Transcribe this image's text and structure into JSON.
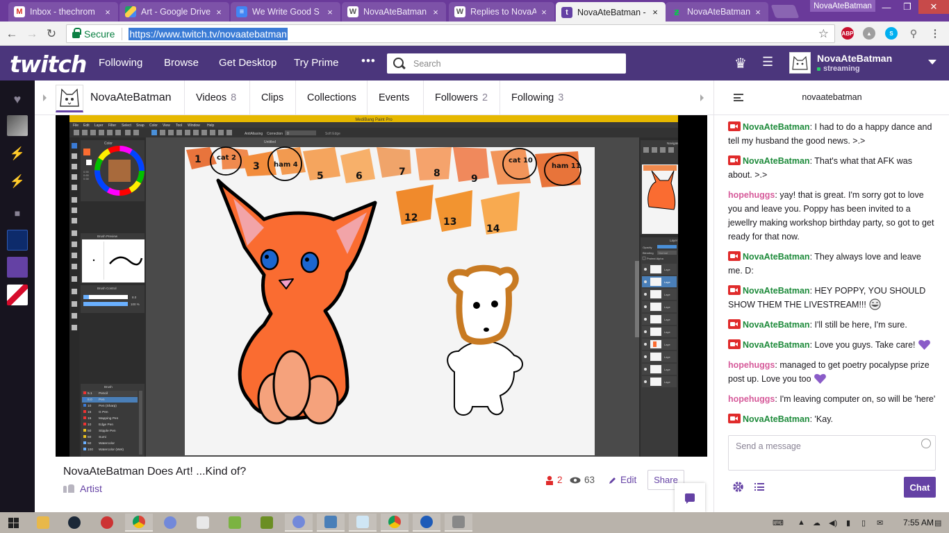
{
  "browser": {
    "tabs": [
      {
        "title": "Inbox - thechrom",
        "favicon": "gmail-icon",
        "color": "#d93025"
      },
      {
        "title": "Art - Google Drive",
        "favicon": "google-drive-icon",
        "color": "#1fa463"
      },
      {
        "title": "We Write Good S",
        "favicon": "google-docs-icon",
        "color": "#4285f4"
      },
      {
        "title": "NovaAteBatman (",
        "favicon": "wordpress-icon",
        "color": "#777"
      },
      {
        "title": "Replies to NovaAt",
        "favicon": "wordpress-icon",
        "color": "#777"
      },
      {
        "title": "NovaAteBatman -",
        "favicon": "twitch-icon",
        "color": "#6441a4",
        "active": true
      },
      {
        "title": "NovaAteBatman (",
        "favicon": "deviantart-icon",
        "color": "#05cc47"
      }
    ],
    "profile_name": "NovaAteBatman",
    "secure_label": "Secure",
    "url": "https://www.twitch.tv/novaatebatman",
    "extensions": [
      "abp-icon",
      "drive-icon",
      "skype-icon",
      "pin-icon"
    ]
  },
  "topnav": {
    "logo": "twitch",
    "links": [
      "Following",
      "Browse",
      "Get Desktop",
      "Try Prime"
    ],
    "more": "•••",
    "search_placeholder": "Search",
    "user": {
      "name": "NovaAteBatman",
      "status": "streaming"
    }
  },
  "channel": {
    "name": "NovaAteBatman",
    "tabs": [
      {
        "label": "Videos",
        "count": "8"
      },
      {
        "label": "Clips",
        "count": ""
      },
      {
        "label": "Collections",
        "count": ""
      },
      {
        "label": "Events",
        "count": ""
      },
      {
        "label": "Followers",
        "count": "2"
      },
      {
        "label": "Following",
        "count": "3"
      }
    ]
  },
  "video": {
    "title": "NovaAteBatman Does Art! ...Kind of?",
    "game": "Artist",
    "viewers": "2",
    "views": "63",
    "edit_label": "Edit",
    "share_label": "Share"
  },
  "stream": {
    "app_title": "MediBang Paint Pro",
    "canvas_title": "Untitled",
    "menu": [
      "File",
      "Edit",
      "Layer",
      "Filter",
      "Select",
      "Snap",
      "Color",
      "View",
      "Tool",
      "Window",
      "Help"
    ],
    "panels": {
      "color": "Color",
      "brush_preview": "Brush Preview",
      "brush_control": "Brush Control",
      "brush": "Brush",
      "navigator": "Navigator",
      "layer": "Layer"
    },
    "brushes": [
      {
        "size": "5.1",
        "name": "Pencil"
      },
      {
        "size": "8.0",
        "name": "Pen"
      },
      {
        "size": "10",
        "name": "Pen (Sharp)"
      },
      {
        "size": "15",
        "name": "G Pen"
      },
      {
        "size": "15",
        "name": "Mapping Pen"
      },
      {
        "size": "10",
        "name": "Edge Pen"
      },
      {
        "size": "50",
        "name": "Stipple Pen"
      },
      {
        "size": "50",
        "name": "Sumi"
      },
      {
        "size": "50",
        "name": "Watercolor"
      },
      {
        "size": "100",
        "name": "Watercolor (Wet)"
      }
    ],
    "swatch_labels": [
      "1",
      "cat 2",
      "3",
      "ham 4",
      "5",
      "6",
      "7",
      "8",
      "9",
      "cat 10",
      "ham 11",
      "12",
      "13",
      "14"
    ],
    "brush_size_values": [
      "8.0",
      "100 %"
    ],
    "color_readout": [
      "0.55",
      "0.65",
      "0.58"
    ],
    "toolbar_labels": {
      "antialias": "AntiAliasing",
      "correction": "Correction",
      "correction_value": "0",
      "soft_edge": "Soft Edge"
    },
    "layer_label": "Laye",
    "opacity_label": "Opacity",
    "blending_label": "Blending",
    "blending_value": "Normal",
    "protect_alpha_label": "Protect Alpha"
  },
  "chat": {
    "room": "novaatebatman",
    "messages": [
      {
        "user": "NovaAteBatman",
        "broadcaster": true,
        "text": "I had to do a happy dance and tell my husband the good news. >.>"
      },
      {
        "user": "NovaAteBatman",
        "broadcaster": true,
        "text": "That's what that AFK was about. >.>"
      },
      {
        "user": "hopehuggs",
        "broadcaster": false,
        "text": "yay! that is great. I'm sorry got to love you and leave you. Poppy has been invited to a jewellry making workshop birthday party, so got to get ready for that now."
      },
      {
        "user": "NovaAteBatman",
        "broadcaster": true,
        "text": "They always love and leave me. D:"
      },
      {
        "user": "NovaAteBatman",
        "broadcaster": true,
        "text": "HEY POPPY, YOU SHOULD SHOW THEM THE LIVESTREAM!!!",
        "emote": "lol-emote"
      },
      {
        "user": "NovaAteBatman",
        "broadcaster": true,
        "text": "I'll still be here, I'm sure."
      },
      {
        "user": "NovaAteBatman",
        "broadcaster": true,
        "text": "Love you guys. Take care!",
        "emote": "purple-heart-emote"
      },
      {
        "user": "hopehuggs",
        "broadcaster": false,
        "text": "managed to get poetry pocalypse prize post up. Love you too",
        "emote": "purple-heart-emote"
      },
      {
        "user": "hopehuggs",
        "broadcaster": false,
        "text": "I'm leaving computer on, so will be 'here'"
      },
      {
        "user": "NovaAteBatman",
        "broadcaster": true,
        "text": "'Kay."
      }
    ],
    "input_placeholder": "Send a message",
    "send_label": "Chat",
    "colors": {
      "broadcaster": "#1d8a3a",
      "viewer": "#d65a9a"
    }
  },
  "taskbar": {
    "clock": "7:55 AM",
    "apps": [
      "file-explorer-icon",
      "steam-icon",
      "app-icon",
      "chrome-icon",
      "discord-icon",
      "minecraft-icon",
      "discord-icon",
      "paint-icon",
      "notepad-icon",
      "chrome-icon",
      "medibang-icon",
      "audio-icon"
    ]
  },
  "colors": {
    "twitch_purple": "#6441a4",
    "nav_bg": "#4b367c",
    "chrome_frame": "#6a3a9a",
    "cat_orange": "#fa6c31",
    "bear_brown": "#c87a22"
  }
}
